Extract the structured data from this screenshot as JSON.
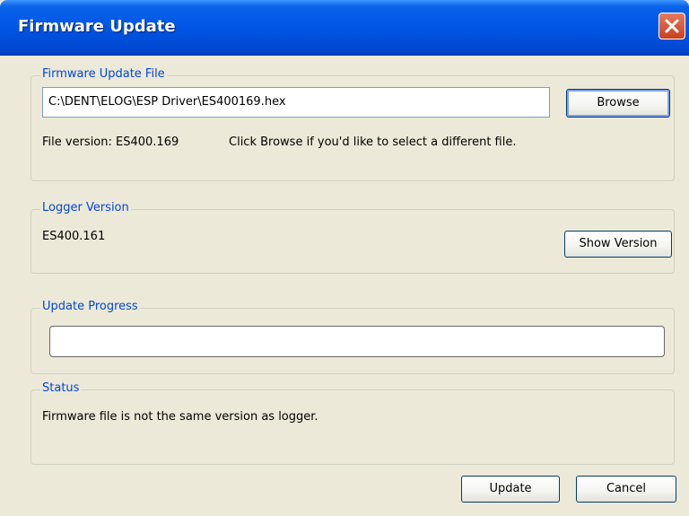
{
  "window": {
    "title": "Firmware Update"
  },
  "firmware_file": {
    "legend": "Firmware Update File",
    "path": "C:\\DENT\\ELOG\\ESP Driver\\ES400169.hex",
    "browse_label": "Browse",
    "version_text": "File version: ES400.169",
    "hint_text": "Click Browse if you'd like to select a different file."
  },
  "logger_version": {
    "legend": "Logger Version",
    "value": "ES400.161",
    "show_version_label": "Show Version"
  },
  "update_progress": {
    "legend": "Update Progress",
    "progress_percent": 0
  },
  "status": {
    "legend": "Status",
    "message": "Firmware file is not the same version as logger."
  },
  "footer": {
    "update_label": "Update",
    "cancel_label": "Cancel"
  },
  "colors": {
    "title_bar": "#0055e5",
    "group_label": "#0046d5",
    "close_button": "#c7411f"
  },
  "icons": {
    "close": "close-x-icon"
  }
}
